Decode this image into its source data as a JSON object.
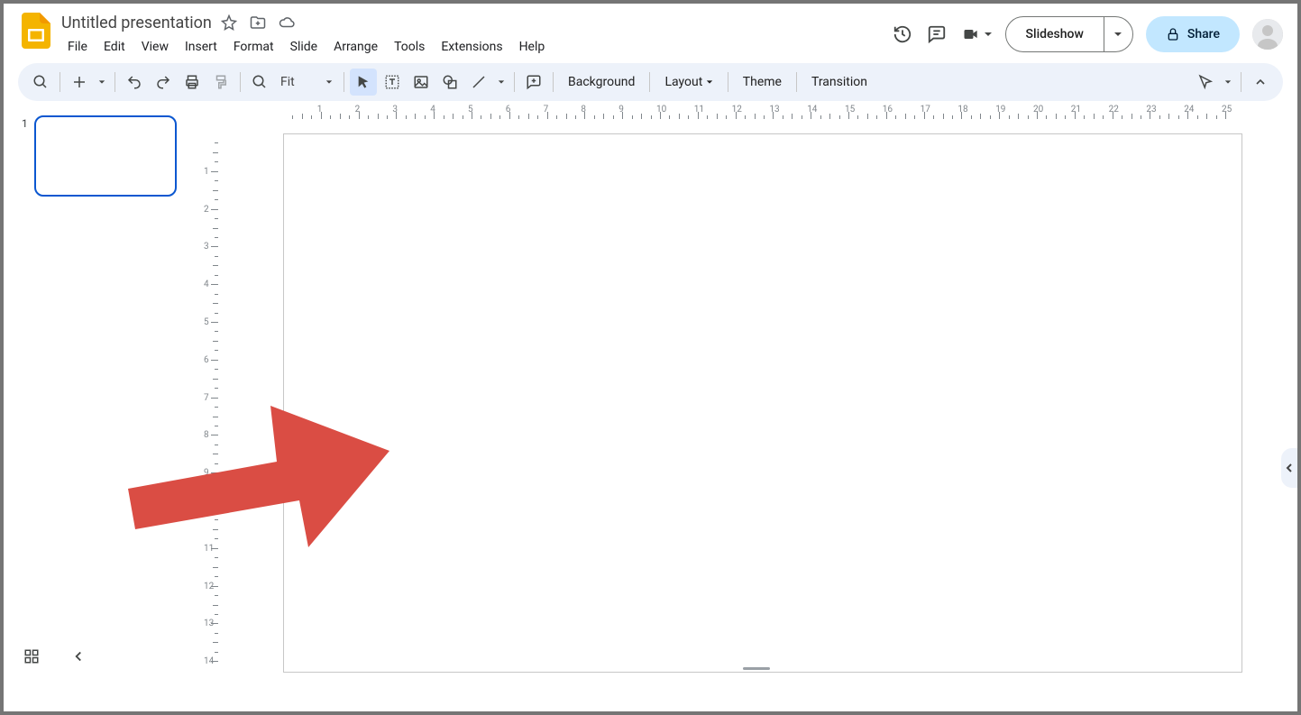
{
  "header": {
    "title": "Untitled presentation",
    "menus": [
      "File",
      "Edit",
      "View",
      "Insert",
      "Format",
      "Slide",
      "Arrange",
      "Tools",
      "Extensions",
      "Help"
    ],
    "slideshow_label": "Slideshow",
    "share_label": "Share"
  },
  "toolbar": {
    "zoom_label": "Fit",
    "background": "Background",
    "layout": "Layout",
    "theme": "Theme",
    "transition": "Transition"
  },
  "filmstrip": {
    "slide_number": "1",
    "ruler_max_h": 25,
    "ruler_max_v": 14
  }
}
